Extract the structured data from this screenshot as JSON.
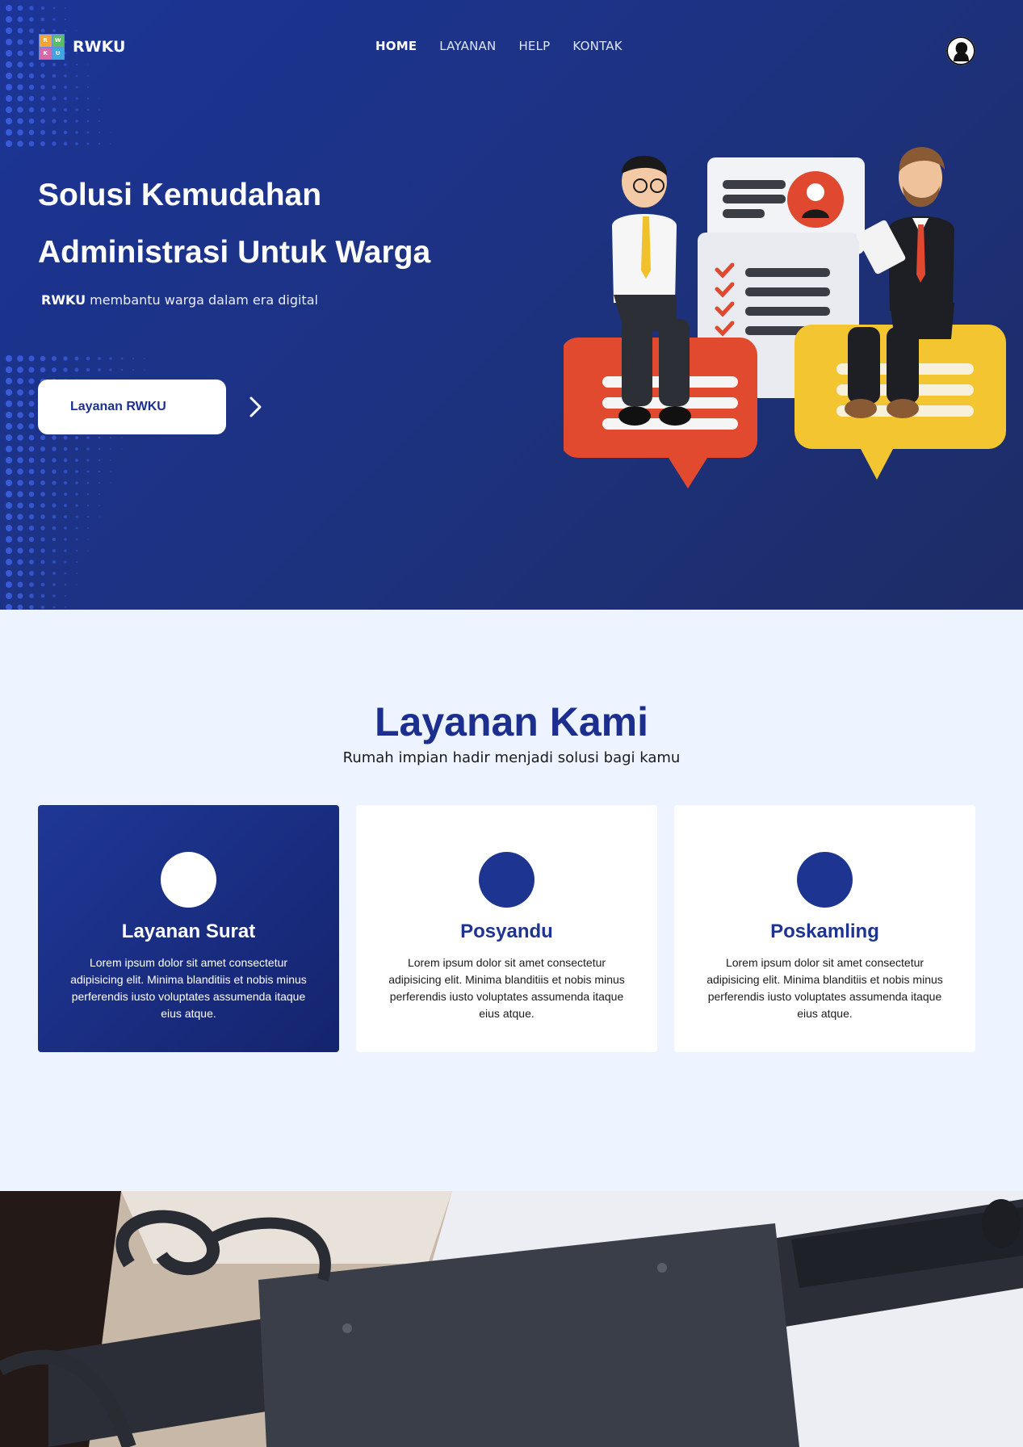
{
  "brand": {
    "name": "RWKU",
    "logo_letters": [
      "R",
      "W",
      "K",
      "U"
    ]
  },
  "nav": {
    "items": [
      {
        "label": "HOME",
        "active": true
      },
      {
        "label": "LAYANAN",
        "active": false
      },
      {
        "label": "HELP",
        "active": false
      },
      {
        "label": "KONTAK",
        "active": false
      }
    ]
  },
  "hero": {
    "title_line1": "Solusi Kemudahan",
    "title_line2": "Administrasi Untuk Warga",
    "subtitle_bold": "RWKU",
    "subtitle_rest": " membantu warga dalam era digital",
    "cta_label": "Layanan RWKU"
  },
  "services": {
    "title": "Layanan Kami",
    "subtitle": "Rumah impian hadir menjadi solusi bagi kamu",
    "cards": [
      {
        "title": "Layanan Surat",
        "text": "Lorem ipsum dolor sit amet consectetur adipisicing elit. Minima blanditiis et nobis minus perferendis iusto voluptates assumenda itaque eius atque."
      },
      {
        "title": "Posyandu",
        "text": "Lorem ipsum dolor sit amet consectetur adipisicing elit. Minima blanditiis et nobis minus perferendis iusto voluptates assumenda itaque eius atque."
      },
      {
        "title": "Poskamling",
        "text": "Lorem ipsum dolor sit amet consectetur adipisicing elit. Minima blanditiis et nobis minus perferendis iusto voluptates assumenda itaque eius atque."
      }
    ]
  },
  "colors": {
    "primary": "#1d3591",
    "hero_bg": "#1d327e",
    "section_bg": "#eef4ff",
    "accent_red": "#e04a2e",
    "accent_yellow": "#f2c531"
  }
}
